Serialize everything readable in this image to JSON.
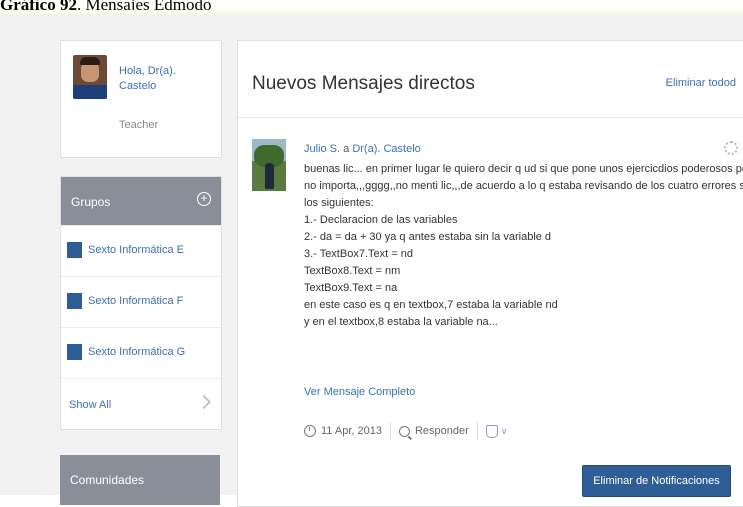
{
  "caption": {
    "bold": "Gráfico 92",
    "rest": ". Mensajes Edmodo"
  },
  "profile": {
    "greeting_line1": "Hola, Dr(a).",
    "greeting_line2": "Castelo",
    "role": "Teacher"
  },
  "groups": {
    "title": "Grupos",
    "items": [
      {
        "label": "Sexto Informática E"
      },
      {
        "label": "Sexto Informática F"
      },
      {
        "label": "Sexto Informática G"
      }
    ],
    "show_all": "Show All"
  },
  "communities": {
    "title": "Comunidades"
  },
  "main": {
    "title": "Nuevos Mensajes directos",
    "delete_all": "Eliminar todod"
  },
  "message": {
    "sender": "Julio S.",
    "connector": " a ",
    "recipient": "Dr(a). Castelo",
    "lines": [
      "buenas lic... en primer lugar le quiero decir q ud si que pone unos ejercicdios poderosos pero",
      "no importa,,,gggg,,no menti lic,,,de acuerdo a lo q estaba revisando de los cuatro errores son",
      "los siguientes:",
      "1.- Declaracion de las variables",
      "2.- da = da + 30 ya q antes estaba sin la variable d",
      "3.- TextBox7.Text = nd",
      "TextBox8.Text = nm",
      "TextBox9.Text = na",
      "en este caso es q en textbox,7 estaba la variable nd",
      "y en el textbox,8 estaba la variable na..."
    ],
    "read_more": "Ver Mensaje Completo",
    "date": "11 Apr, 2013",
    "reply": "Responder",
    "remove_button": "Eliminar de Notificaciones"
  },
  "icons": {
    "add_group": "plus-circle-icon",
    "show_all": "chevron-right-icon",
    "settings": "gear-icon",
    "date": "clock-icon",
    "reply": "search-bubble-icon",
    "badge": "badge-icon"
  },
  "colors": {
    "link": "#3d6fb0",
    "panel_header": "#898e99",
    "button": "#2f5e96",
    "group_square": "#2e5d95"
  }
}
